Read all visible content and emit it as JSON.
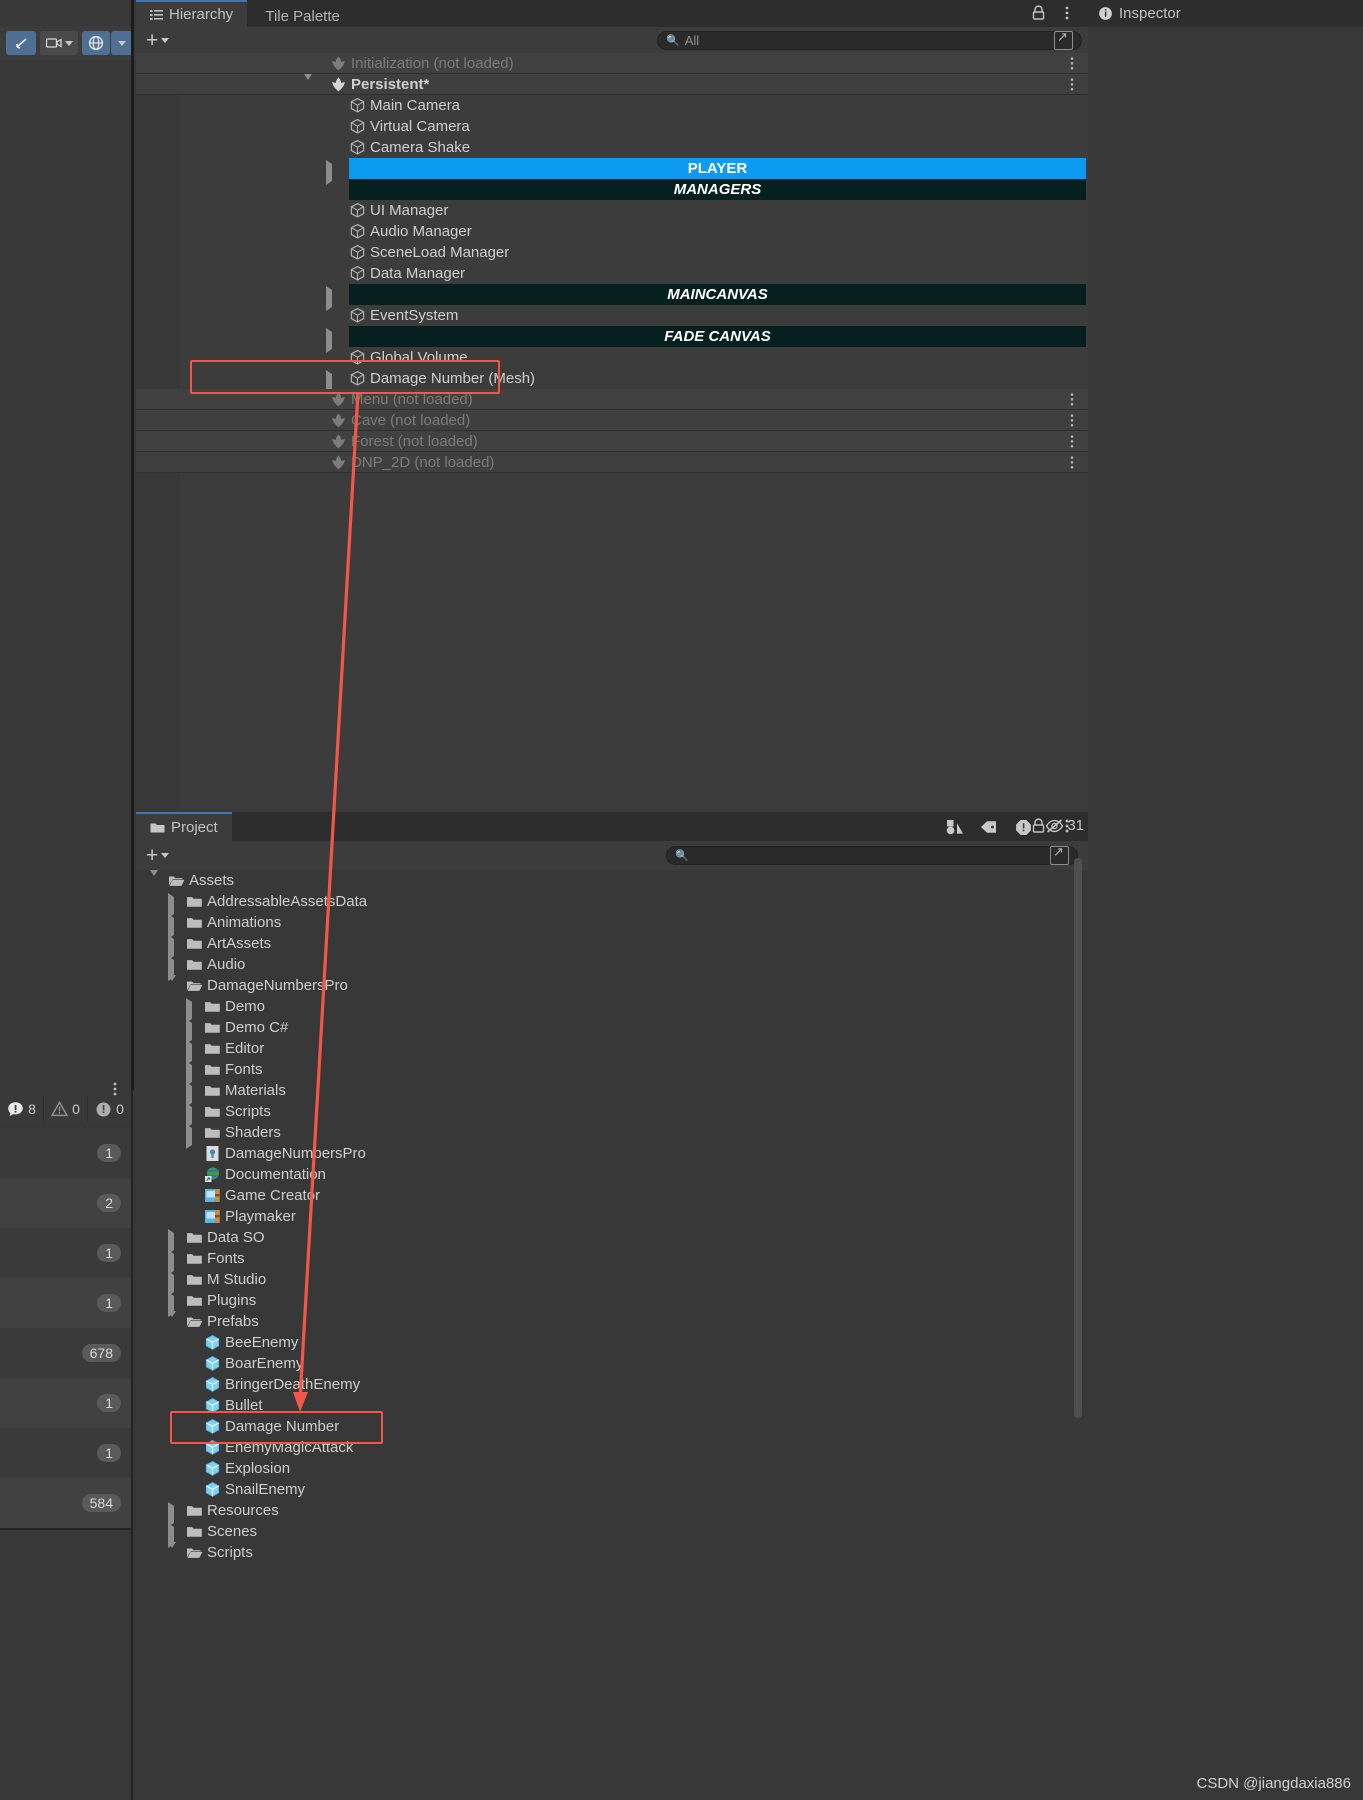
{
  "window": {
    "watermark": "CSDN @jiangdaxia886"
  },
  "inspector": {
    "tab_label": "Inspector",
    "icon": "info-icon"
  },
  "left_toolbar": {
    "buttons": [
      "hand-tool-icon",
      "camera-icon",
      "globe-icon",
      "dropdown-icon"
    ]
  },
  "console_counts": [
    {
      "icon": "error-icon",
      "value": "8"
    },
    {
      "icon": "warning-icon",
      "value": "0"
    },
    {
      "icon": "info-icon",
      "value": "0"
    }
  ],
  "left_numbers": [
    "1",
    "2",
    "1",
    "1",
    "678",
    "1",
    "1",
    "584"
  ],
  "hierarchy": {
    "tabs": [
      {
        "label": "Hierarchy",
        "icon": "hierarchy-icon",
        "active": true
      },
      {
        "label": "Tile Palette",
        "icon": "",
        "active": false
      }
    ],
    "lock_icon": "lock-icon",
    "menu_icon": "kebab-menu-icon",
    "toolbar": {
      "add_label": "+",
      "search_placeholder": "All",
      "search_value": "All"
    },
    "rows": [
      {
        "label": "Initialization (not loaded)",
        "type": "scene",
        "state": "unloaded",
        "indent": 1,
        "twisty": "none",
        "kebab": true
      },
      {
        "label": "Persistent*",
        "type": "scene",
        "state": "loaded",
        "indent": 1,
        "twisty": "open",
        "kebab": true,
        "bold": true
      },
      {
        "label": "Main Camera",
        "type": "gameobject",
        "indent": 2,
        "twisty": "none"
      },
      {
        "label": "Virtual Camera",
        "type": "gameobject",
        "indent": 2,
        "twisty": "none"
      },
      {
        "label": "Camera Shake",
        "type": "gameobject",
        "indent": 2,
        "twisty": "none"
      },
      {
        "label": "PLAYER",
        "type": "bar-blue",
        "indent": 2,
        "twisty": "closed"
      },
      {
        "label": "MANAGERS",
        "type": "bar-dark",
        "indent": 2,
        "twisty": "none"
      },
      {
        "label": "UI Manager",
        "type": "gameobject",
        "indent": 2,
        "twisty": "none"
      },
      {
        "label": "Audio Manager",
        "type": "gameobject",
        "indent": 2,
        "twisty": "none"
      },
      {
        "label": "SceneLoad Manager",
        "type": "gameobject",
        "indent": 2,
        "twisty": "none"
      },
      {
        "label": "Data Manager",
        "type": "gameobject",
        "indent": 2,
        "twisty": "none"
      },
      {
        "label": "MAINCANVAS",
        "type": "bar-dark",
        "indent": 2,
        "twisty": "closed"
      },
      {
        "label": "EventSystem",
        "type": "gameobject",
        "indent": 2,
        "twisty": "none"
      },
      {
        "label": "FADE CANVAS",
        "type": "bar-dark",
        "indent": 2,
        "twisty": "closed"
      },
      {
        "label": "Global Volume",
        "type": "gameobject",
        "indent": 2,
        "twisty": "none"
      },
      {
        "label": "Damage Number (Mesh)",
        "type": "gameobject",
        "indent": 2,
        "twisty": "closed",
        "highlighted": true
      },
      {
        "label": "Menu (not loaded)",
        "type": "scene",
        "state": "unloaded",
        "indent": 1,
        "twisty": "none",
        "kebab": true
      },
      {
        "label": "Cave (not loaded)",
        "type": "scene",
        "state": "unloaded",
        "indent": 1,
        "twisty": "none",
        "kebab": true
      },
      {
        "label": "Forest (not loaded)",
        "type": "scene",
        "state": "unloaded",
        "indent": 1,
        "twisty": "none",
        "kebab": true
      },
      {
        "label": "DNP_2D (not loaded)",
        "type": "scene",
        "state": "unloaded",
        "indent": 1,
        "twisty": "none",
        "kebab": true
      }
    ]
  },
  "project": {
    "tab_label": "Project",
    "tab_icon": "folder-icon",
    "lock_icon": "lock-icon",
    "menu_icon": "kebab-menu-icon",
    "toolbar": {
      "add_label": "+",
      "search_value": "",
      "icons": [
        "shapes-icon",
        "tag-icon",
        "warning-circle-icon"
      ],
      "hidden_count_icon": "eye-slash-icon",
      "hidden_count": "31"
    },
    "rows": [
      {
        "label": "Assets",
        "icon": "folder-open-icon",
        "indent": 0,
        "twisty": "open"
      },
      {
        "label": "AddressableAssetsData",
        "icon": "folder-icon",
        "indent": 1,
        "twisty": "closed"
      },
      {
        "label": "Animations",
        "icon": "folder-icon",
        "indent": 1,
        "twisty": "closed"
      },
      {
        "label": "ArtAssets",
        "icon": "folder-icon",
        "indent": 1,
        "twisty": "closed"
      },
      {
        "label": "Audio",
        "icon": "folder-icon",
        "indent": 1,
        "twisty": "closed"
      },
      {
        "label": "DamageNumbersPro",
        "icon": "folder-open-icon",
        "indent": 1,
        "twisty": "open"
      },
      {
        "label": "Demo",
        "icon": "folder-icon",
        "indent": 2,
        "twisty": "closed"
      },
      {
        "label": "Demo C#",
        "icon": "folder-icon",
        "indent": 2,
        "twisty": "closed"
      },
      {
        "label": "Editor",
        "icon": "folder-icon",
        "indent": 2,
        "twisty": "closed"
      },
      {
        "label": "Fonts",
        "icon": "folder-icon",
        "indent": 2,
        "twisty": "closed"
      },
      {
        "label": "Materials",
        "icon": "folder-icon",
        "indent": 2,
        "twisty": "closed"
      },
      {
        "label": "Scripts",
        "icon": "folder-icon",
        "indent": 2,
        "twisty": "closed"
      },
      {
        "label": "Shaders",
        "icon": "folder-icon",
        "indent": 2,
        "twisty": "closed"
      },
      {
        "label": "DamageNumbersPro",
        "icon": "document-icon",
        "indent": 2,
        "twisty": "none"
      },
      {
        "label": "Documentation",
        "icon": "globe-shortcut-icon",
        "indent": 2,
        "twisty": "none"
      },
      {
        "label": "Game Creator",
        "icon": "package-icon",
        "indent": 2,
        "twisty": "none"
      },
      {
        "label": "Playmaker",
        "icon": "package-icon",
        "indent": 2,
        "twisty": "none"
      },
      {
        "label": "Data SO",
        "icon": "folder-icon",
        "indent": 1,
        "twisty": "closed"
      },
      {
        "label": "Fonts",
        "icon": "folder-icon",
        "indent": 1,
        "twisty": "closed"
      },
      {
        "label": "M Studio",
        "icon": "folder-icon",
        "indent": 1,
        "twisty": "closed"
      },
      {
        "label": "Plugins",
        "icon": "folder-icon",
        "indent": 1,
        "twisty": "closed"
      },
      {
        "label": "Prefabs",
        "icon": "folder-open-icon",
        "indent": 1,
        "twisty": "open"
      },
      {
        "label": "BeeEnemy",
        "icon": "prefab-icon",
        "indent": 2,
        "twisty": "none"
      },
      {
        "label": "BoarEnemy",
        "icon": "prefab-icon",
        "indent": 2,
        "twisty": "none"
      },
      {
        "label": "BringerDeathEnemy",
        "icon": "prefab-icon",
        "indent": 2,
        "twisty": "none"
      },
      {
        "label": "Bullet",
        "icon": "prefab-icon",
        "indent": 2,
        "twisty": "none"
      },
      {
        "label": "Damage Number",
        "icon": "prefab-icon",
        "indent": 2,
        "twisty": "none",
        "highlighted": true
      },
      {
        "label": "EnemyMagicAttack",
        "icon": "prefab-icon",
        "indent": 2,
        "twisty": "none"
      },
      {
        "label": "Explosion",
        "icon": "prefab-icon",
        "indent": 2,
        "twisty": "none"
      },
      {
        "label": "SnailEnemy",
        "icon": "prefab-icon",
        "indent": 2,
        "twisty": "none"
      },
      {
        "label": "Resources",
        "icon": "folder-icon",
        "indent": 1,
        "twisty": "closed"
      },
      {
        "label": "Scenes",
        "icon": "folder-icon",
        "indent": 1,
        "twisty": "closed"
      },
      {
        "label": "Scripts",
        "icon": "folder-open-icon",
        "indent": 1,
        "twisty": "open"
      }
    ]
  },
  "annotation": {
    "color": "#f4564a",
    "description": "arrow from Damage Number (Mesh) in Hierarchy to Damage Number prefab in Project"
  }
}
